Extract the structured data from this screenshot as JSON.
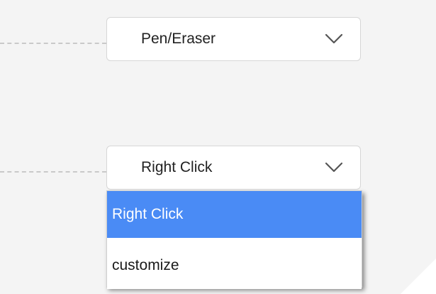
{
  "rows": [
    {
      "id": "row-1",
      "select": {
        "value": "Pen/Eraser",
        "expanded": false
      }
    },
    {
      "id": "row-2",
      "select": {
        "value": "Right Click",
        "expanded": true,
        "options": [
          {
            "label": "Right Click",
            "selected": true
          },
          {
            "label": "customize",
            "selected": false
          }
        ]
      }
    }
  ],
  "icons": {
    "dropdown": "chevron-down-icon"
  },
  "colors": {
    "background": "#f4f4f4",
    "highlight": "#4a8bf5",
    "leader_line": "#c9c9c9",
    "chevron": "#555555"
  }
}
